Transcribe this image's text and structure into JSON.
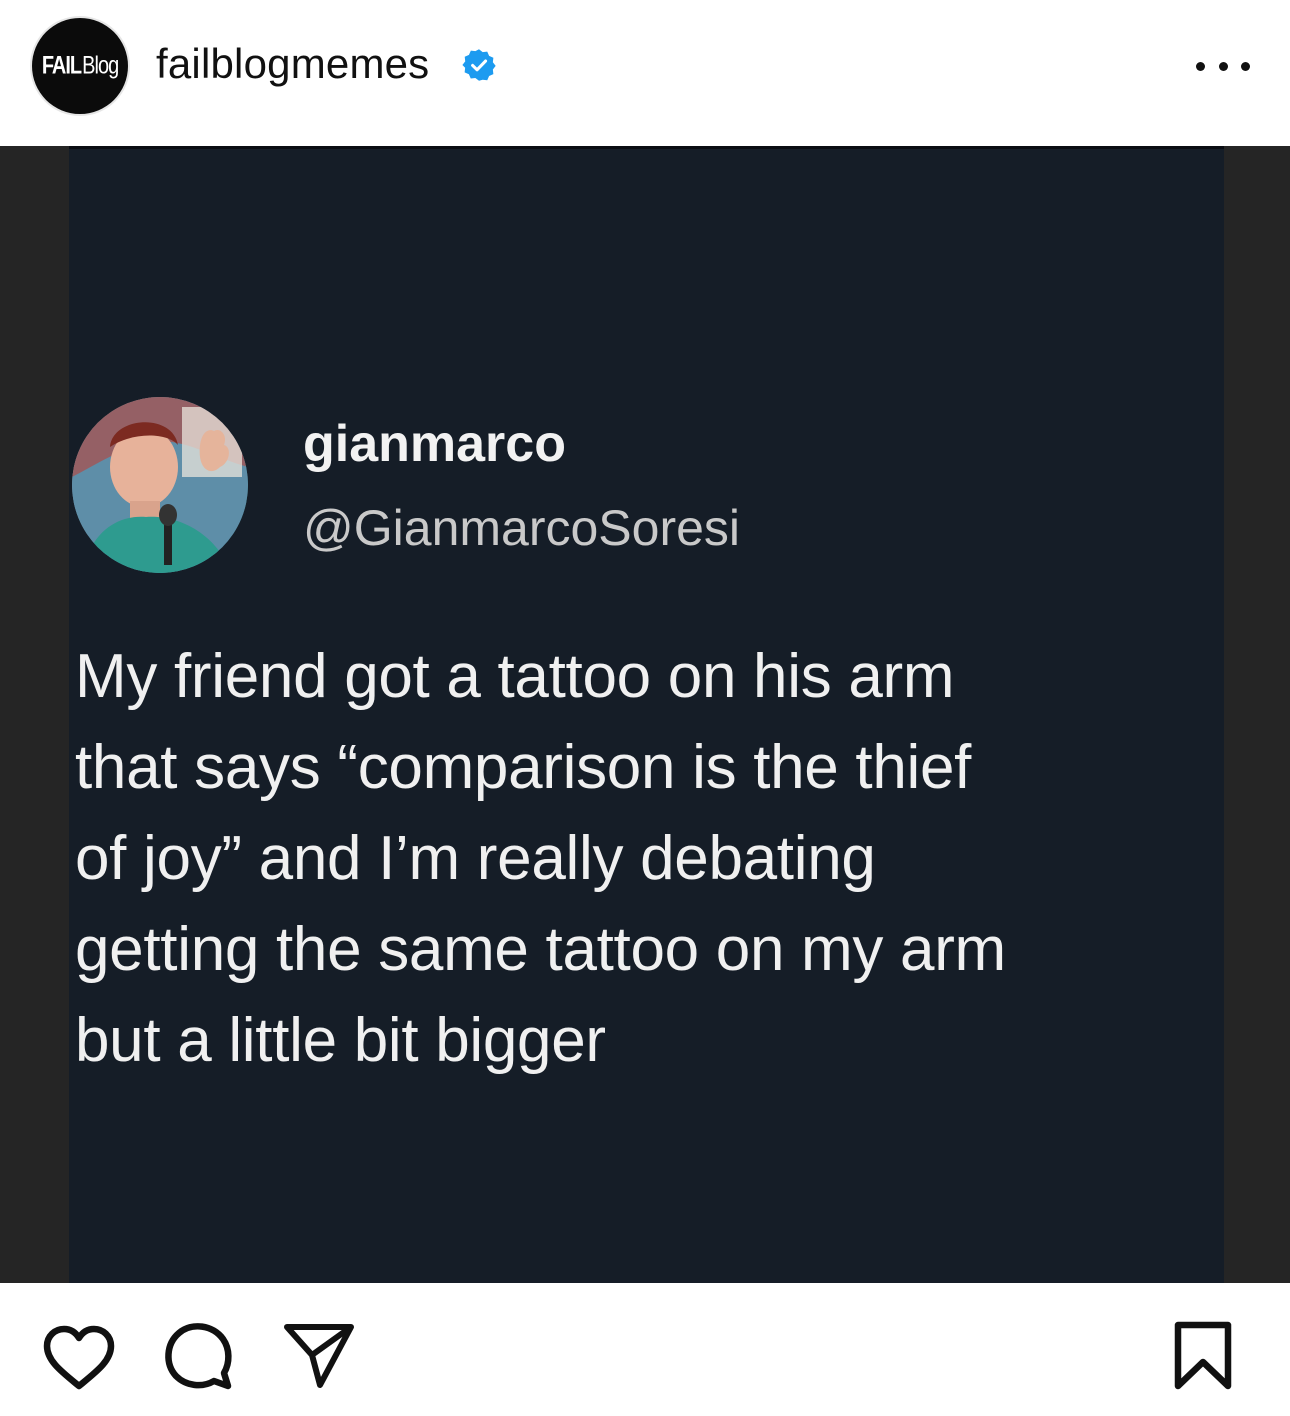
{
  "header": {
    "avatar_logo": {
      "part1": "FAIL",
      "part2": "Blog"
    },
    "account_name": "failblogmemes",
    "verified_icon": "verified-badge-icon",
    "more_icon": "more-options-icon"
  },
  "tweet": {
    "display_name": "gianmarco",
    "handle": "@GianmarcoSoresi",
    "text": "My friend got a tattoo on his arm\nthat says “comparison is the thief\nof joy” and I’m really debating\ngetting the same tattoo on my arm\nbut a little bit bigger"
  },
  "actions": {
    "like_icon": "heart-icon",
    "comment_icon": "comment-bubble-icon",
    "share_icon": "paper-plane-icon",
    "save_icon": "bookmark-icon"
  },
  "colors": {
    "verified_blue": "#1d9bf0",
    "tweet_background": "#151d27",
    "letterbox": "#252525"
  }
}
